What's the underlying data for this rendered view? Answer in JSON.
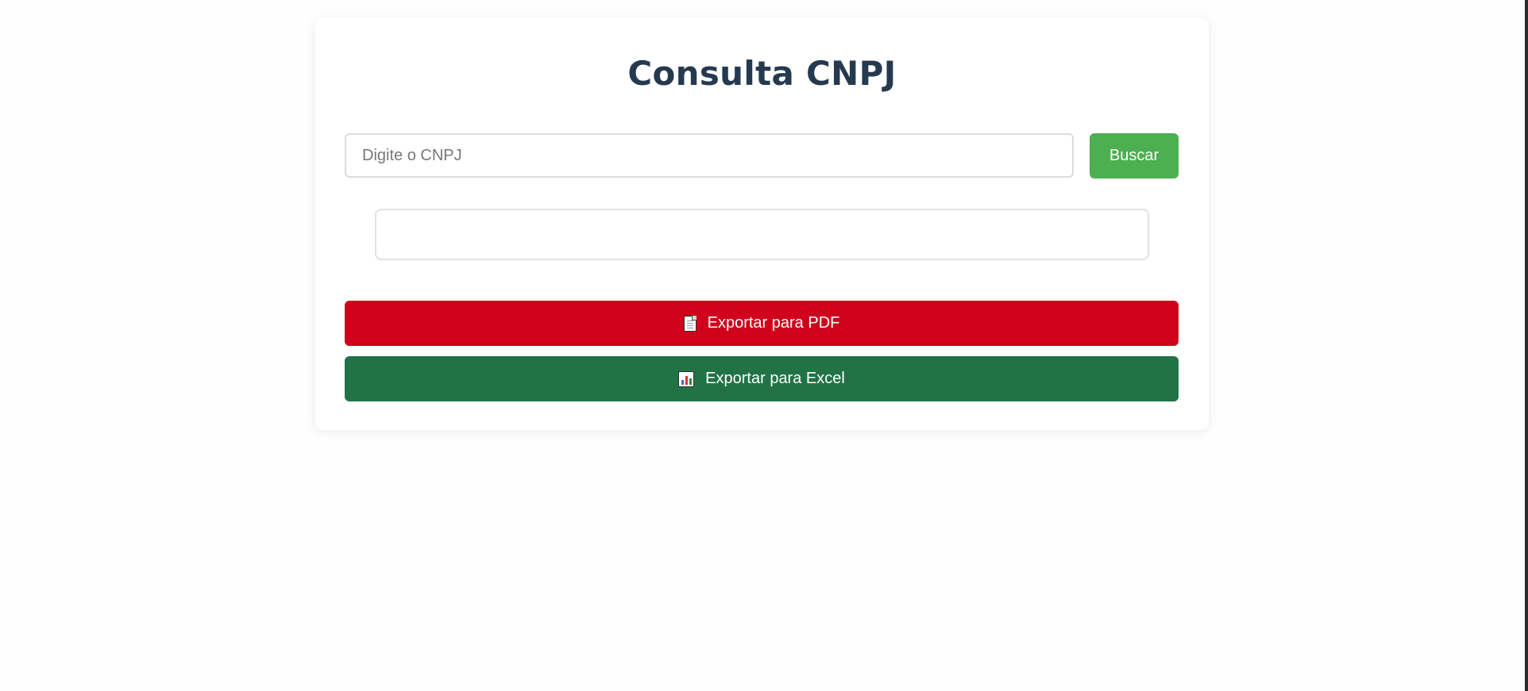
{
  "header": {
    "title": "Consulta CNPJ"
  },
  "search": {
    "placeholder": "Digite o CNPJ",
    "value": "",
    "button_label": "Buscar"
  },
  "result": {
    "text": ""
  },
  "export": {
    "pdf": {
      "label": "Exportar para PDF",
      "icon": "page-facing-up-icon"
    },
    "excel": {
      "label": "Exportar para Excel",
      "icon": "bar-chart-icon"
    }
  },
  "colors": {
    "title": "#263a4f",
    "search_button": "#4caf50",
    "pdf_button": "#d0021b",
    "excel_button": "#217346"
  }
}
